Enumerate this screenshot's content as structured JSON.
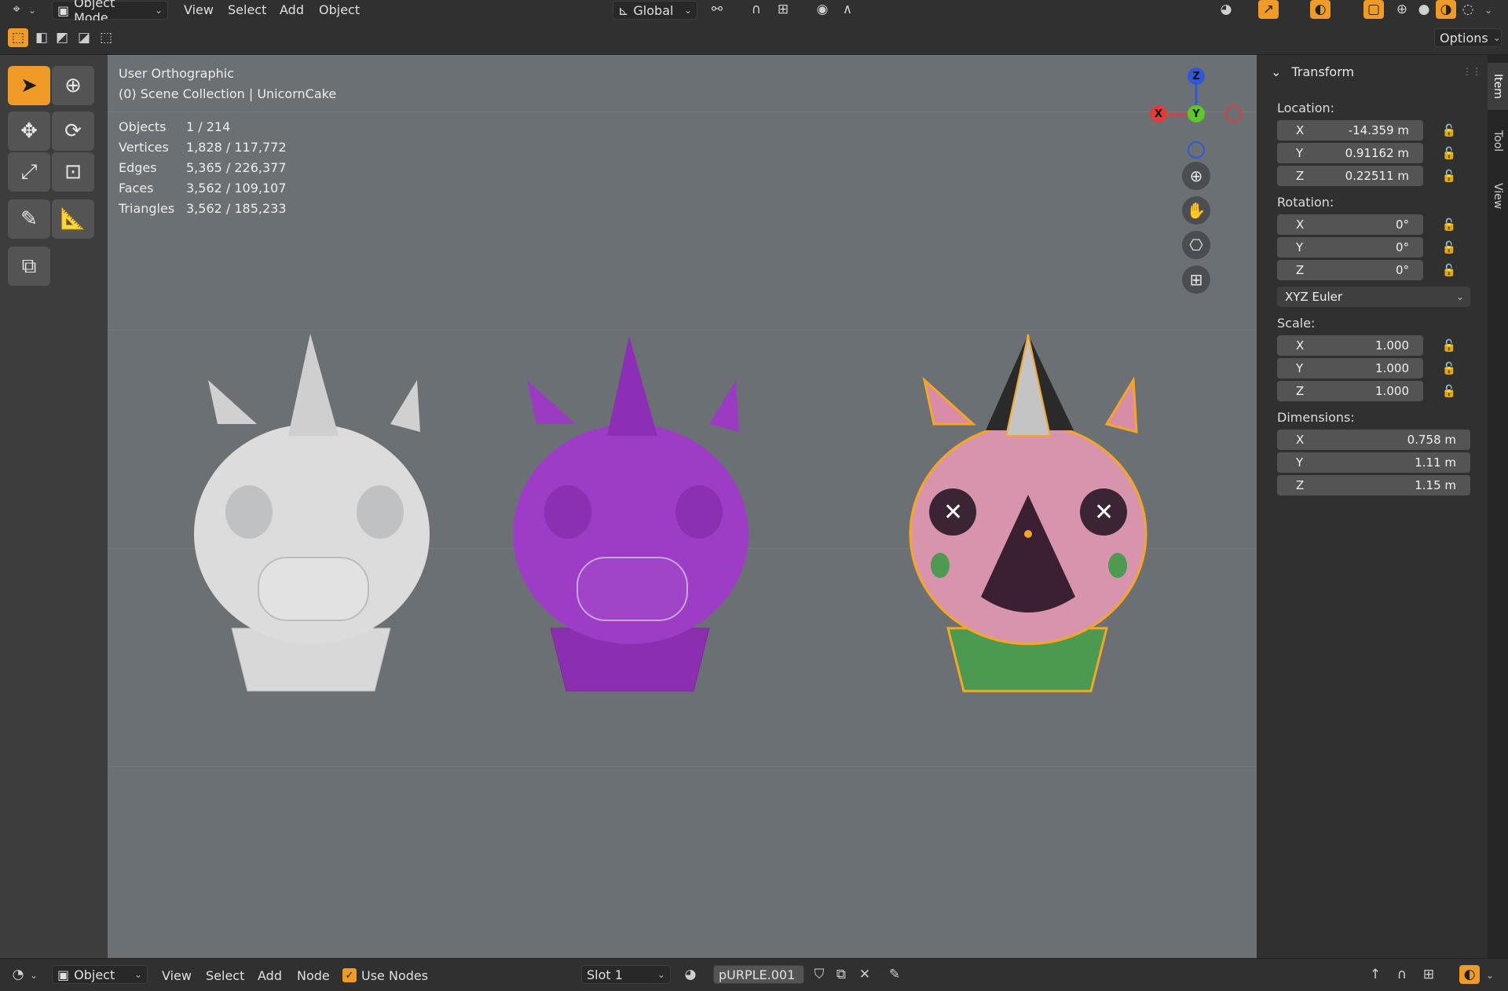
{
  "header": {
    "editor_icon": "cube-editor-icon",
    "mode": "Object Mode",
    "menus": [
      "View",
      "Select",
      "Add",
      "Object"
    ],
    "orientation": "Global",
    "options": "Options"
  },
  "viewport": {
    "view_name": "User Orthographic",
    "collection": "(0) Scene Collection | UnicornCake",
    "stats": [
      {
        "label": "Objects",
        "value": "1 / 214"
      },
      {
        "label": "Vertices",
        "value": "1,828 / 117,772"
      },
      {
        "label": "Edges",
        "value": "5,365 / 226,377"
      },
      {
        "label": "Faces",
        "value": "3,562 / 109,107"
      },
      {
        "label": "Triangles",
        "value": "3,562 / 185,233"
      }
    ],
    "gizmo": {
      "x": "X",
      "y": "Y",
      "z": "Z"
    }
  },
  "transform": {
    "title": "Transform",
    "location_label": "Location:",
    "location": [
      {
        "axis": "X",
        "value": "-14.359 m"
      },
      {
        "axis": "Y",
        "value": "0.91162 m"
      },
      {
        "axis": "Z",
        "value": "0.22511 m"
      }
    ],
    "rotation_label": "Rotation:",
    "rotation": [
      {
        "axis": "X",
        "value": "0°"
      },
      {
        "axis": "Y",
        "value": "0°"
      },
      {
        "axis": "Z",
        "value": "0°"
      }
    ],
    "rotation_mode": "XYZ Euler",
    "scale_label": "Scale:",
    "scale": [
      {
        "axis": "X",
        "value": "1.000"
      },
      {
        "axis": "Y",
        "value": "1.000"
      },
      {
        "axis": "Z",
        "value": "1.000"
      }
    ],
    "dimensions_label": "Dimensions:",
    "dimensions": [
      {
        "axis": "X",
        "value": "0.758 m"
      },
      {
        "axis": "Y",
        "value": "1.11 m"
      },
      {
        "axis": "Z",
        "value": "1.15 m"
      }
    ]
  },
  "sidebar_tabs": [
    "Item",
    "Tool",
    "View"
  ],
  "bottom": {
    "type": "Object",
    "menus": [
      "View",
      "Select",
      "Add",
      "Node"
    ],
    "use_nodes": "Use Nodes",
    "slot": "Slot 1",
    "material": "pURPLE.001"
  },
  "colors": {
    "accent": "#f09a28",
    "viewport_bg": "#6b7074",
    "axis_x": "#e03c3c",
    "axis_y": "#5ec82a",
    "axis_z": "#3157d6",
    "selection_outline": "#f5a623"
  }
}
